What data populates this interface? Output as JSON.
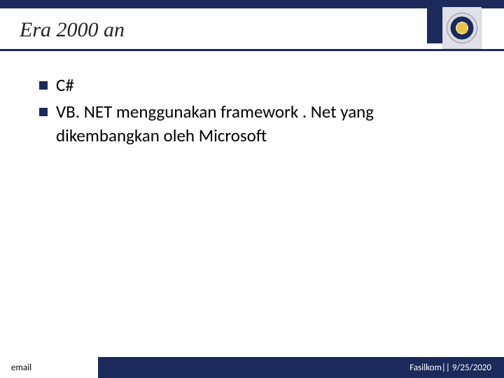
{
  "header": {
    "title": "Era 2000 an"
  },
  "bullets": [
    {
      "text": "C#"
    },
    {
      "text": "VB. NET menggunakan framework . Net yang dikembangkan oleh Microsoft"
    }
  ],
  "footer": {
    "left": "email",
    "right": "Fasilkom|| 9/25/2020"
  }
}
